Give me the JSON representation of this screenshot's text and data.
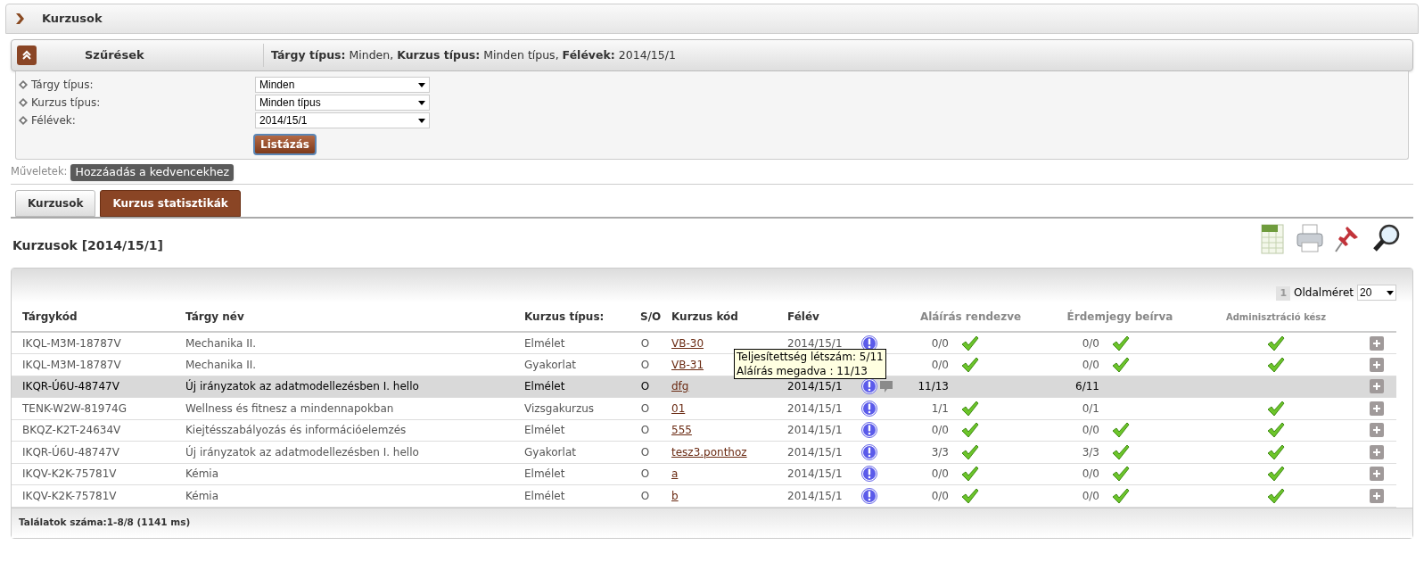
{
  "page_title": "Kurzusok",
  "filter": {
    "title": "Szűrések",
    "summary": "**Tárgy típus:** Minden, **Kurzus típus:** Minden típus, **Félévek:** 2014/15/1",
    "fields": [
      {
        "label": "Tárgy típus:",
        "value": "Minden"
      },
      {
        "label": "Kurzus típus:",
        "value": "Minden típus"
      },
      {
        "label": "Félévek:",
        "value": "2014/15/1"
      }
    ],
    "button": "Listázás"
  },
  "actions": {
    "label": "Műveletek:",
    "buttons": [
      "Hozzáadás a kedvencekhez"
    ]
  },
  "tabs": [
    {
      "label": "Kurzusok",
      "selected": false
    },
    {
      "label": "Kurzus statisztikák",
      "selected": true
    }
  ],
  "list_title": "Kurzusok [2014/15/1]",
  "pager": {
    "page": "1",
    "page_size_label": "Oldalméret",
    "page_size": "20"
  },
  "table": {
    "columns": [
      "Tárgykód",
      "Tárgy név",
      "Kurzus típus:",
      "S/O",
      "Kurzus kód",
      "Félév",
      "Aláírás rendezve",
      "Érdemjegy beírva",
      "Adminisztráció kész"
    ],
    "rows": [
      {
        "code": "IKQL-M3M-18787V",
        "name": "Mechanika II.",
        "type": "Elmélet",
        "so": "O",
        "course": "VB-30",
        "semester": "2014/15/1",
        "info": true,
        "comment": false,
        "signature": "0/0",
        "signature_ok": true,
        "grade": "0/0",
        "grade_ok": true,
        "admin_done": true,
        "selected": false
      },
      {
        "code": "IKQL-M3M-18787V",
        "name": "Mechanika II.",
        "type": "Gyakorlat",
        "so": "O",
        "course": "VB-31",
        "info": false,
        "comment": false,
        "signature": "0/0",
        "signature_ok": true,
        "grade": "0/0",
        "grade_ok": true,
        "admin_done": true,
        "selected": false,
        "tooltip": [
          "Teljesítettség létszám: 5/11",
          "Aláírás megadva : 11/13"
        ]
      },
      {
        "code": "IKQR-Ú6U-48747V",
        "name": "Új irányzatok az adatmodellezésben I. hello",
        "type": "Elmélet",
        "so": "O",
        "course": "dfg",
        "semester": "2014/15/1",
        "info": true,
        "comment": true,
        "signature": "11/13",
        "signature_ok": false,
        "grade": "6/11",
        "grade_ok": false,
        "admin_done": false,
        "selected": true
      },
      {
        "code": "TENK-W2W-81974G",
        "name": "Wellness és fitnesz a mindennapokban",
        "type": "Vizsgakurzus",
        "so": "O",
        "course": "01",
        "semester": "2014/15/1",
        "info": true,
        "comment": false,
        "signature": "1/1",
        "signature_ok": true,
        "grade": "0/1",
        "grade_ok": false,
        "admin_done": true,
        "selected": false
      },
      {
        "code": "BKQZ-K2T-24634V",
        "name": "Kiejtésszabályozás és információelemzés",
        "type": "Elmélet",
        "so": "O",
        "course": "555",
        "semester": "2014/15/1",
        "info": true,
        "comment": false,
        "signature": "0/0",
        "signature_ok": true,
        "grade": "0/0",
        "grade_ok": true,
        "admin_done": true,
        "selected": false
      },
      {
        "code": "IKQR-Ú6U-48747V",
        "name": "Új irányzatok az adatmodellezésben I. hello",
        "type": "Gyakorlat",
        "so": "O",
        "course": "tesz3.ponthoz",
        "semester": "2014/15/1",
        "info": true,
        "comment": false,
        "signature": "3/3",
        "signature_ok": true,
        "grade": "3/3",
        "grade_ok": true,
        "admin_done": true,
        "selected": false
      },
      {
        "code": "IKQV-K2K-75781V",
        "name": "Kémia",
        "type": "Elmélet",
        "so": "O",
        "course": "a",
        "semester": "2014/15/1",
        "info": true,
        "comment": false,
        "signature": "0/0",
        "signature_ok": true,
        "grade": "0/0",
        "grade_ok": true,
        "admin_done": true,
        "selected": false
      },
      {
        "code": "IKQV-K2K-75781V",
        "name": "Kémia",
        "type": "Elmélet",
        "so": "O",
        "course": "b",
        "semester": "2014/15/1",
        "info": true,
        "comment": false,
        "signature": "0/0",
        "signature_ok": true,
        "grade": "0/0",
        "grade_ok": true,
        "admin_done": true,
        "selected": false
      }
    ]
  },
  "footer": "Találatok száma:1-8/8 (1141 ms)"
}
